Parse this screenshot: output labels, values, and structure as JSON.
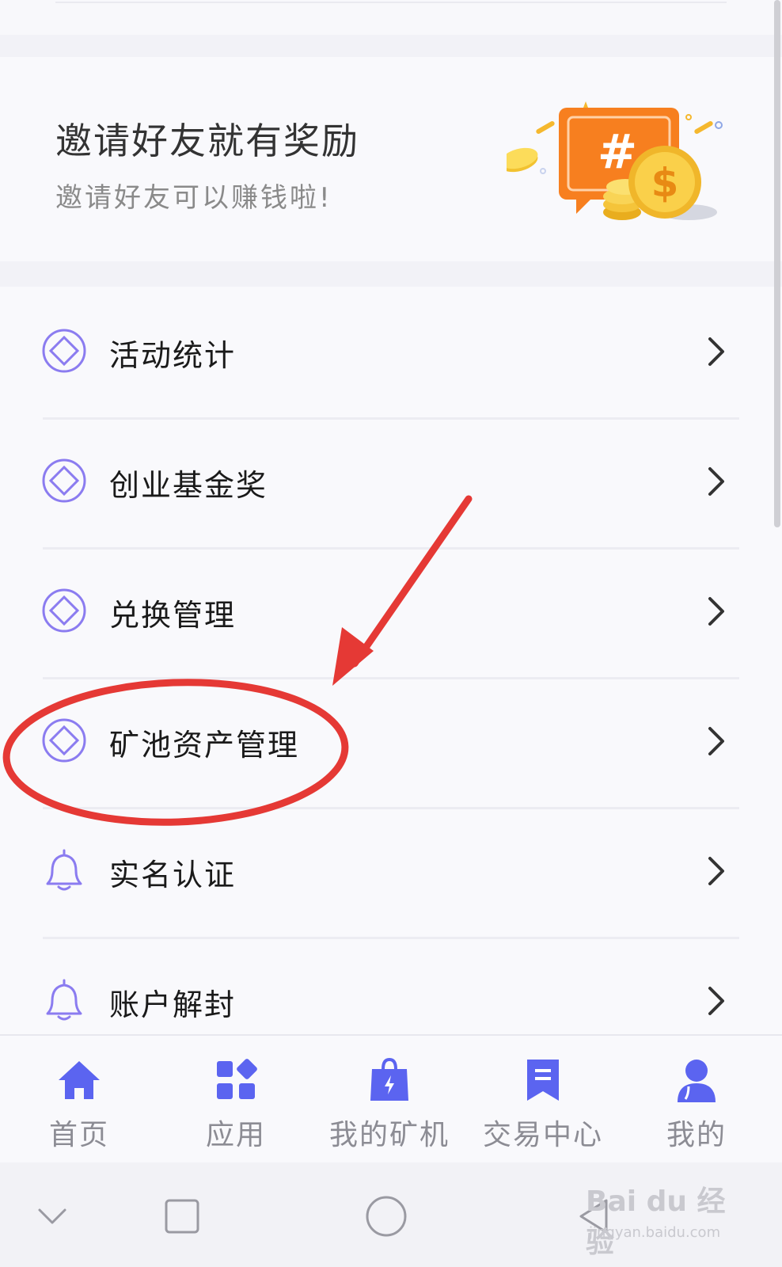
{
  "banner": {
    "title": "邀请好友就有奖励",
    "subtitle": "邀请好友可以赚钱啦!",
    "illustration": "reward-coins-illustration"
  },
  "menu": {
    "items": [
      {
        "label": "活动统计",
        "icon": "diamond-ring-icon"
      },
      {
        "label": "创业基金奖",
        "icon": "diamond-ring-icon"
      },
      {
        "label": "兑换管理",
        "icon": "diamond-ring-icon"
      },
      {
        "label": "矿池资产管理",
        "icon": "diamond-ring-icon"
      },
      {
        "label": "实名认证",
        "icon": "bell-icon"
      },
      {
        "label": "账户解封",
        "icon": "bell-icon"
      }
    ],
    "chevron_icon": "chevron-right-icon"
  },
  "tabbar": {
    "tabs": [
      {
        "label": "首页",
        "icon": "home-icon"
      },
      {
        "label": "应用",
        "icon": "apps-grid-icon"
      },
      {
        "label": "我的矿机",
        "icon": "bag-lightning-icon"
      },
      {
        "label": "交易中心",
        "icon": "bookmark-doc-icon"
      },
      {
        "label": "我的",
        "icon": "user-icon"
      }
    ]
  },
  "navbar": {
    "buttons": [
      "chevron-down-icon",
      "square-recents-icon",
      "circle-home-icon",
      "triangle-back-icon"
    ]
  },
  "watermark": {
    "main": "Bai du 经验",
    "sub": "jingyan.baidu.com"
  },
  "colors": {
    "accent": "#5b64f0",
    "icon_ring": "#8b7cf0",
    "annotation_red": "#e53935",
    "tab_inactive": "#8c8c94"
  }
}
